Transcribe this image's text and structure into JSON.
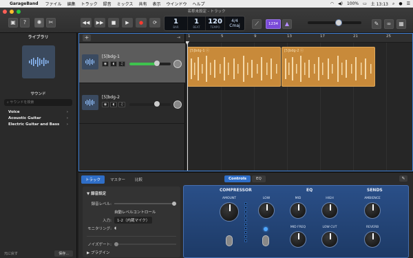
{
  "menubar": {
    "apple": "",
    "app": "GarageBand",
    "items": [
      "ファイル",
      "編集",
      "トラック",
      "録音",
      "ミックス",
      "共有",
      "表示",
      "ウインドウ",
      "ヘルプ"
    ],
    "battery": "100%",
    "time": "土 13:13"
  },
  "window": {
    "title": "名称未設定 - トラック"
  },
  "lcd": {
    "bar": "1",
    "beat": "1",
    "bar_label": "BAR",
    "beat_label": "BEAT",
    "tempo": "120",
    "tempo_label": "TEMPO",
    "sig": "4/4",
    "key": "Cmaj"
  },
  "transport": {
    "count_in": "1234"
  },
  "library": {
    "title": "ライブラリ",
    "sounds_title": "サウンド",
    "search_placeholder": "サウンドを検索",
    "items": [
      "Voice",
      "Acoustic Guitar",
      "Electric Guitar and Bass"
    ],
    "revert": "元に戻す",
    "save": "保存..."
  },
  "tracks": [
    {
      "name": "[5]bdg-1",
      "level": 0.62
    },
    {
      "name": "[5]bdg-2",
      "level": 0.0
    }
  ],
  "ruler": [
    "1",
    "5",
    "9",
    "13",
    "17",
    "21",
    "25"
  ],
  "regions": [
    {
      "name": "[5]bdg-1 ⓒ"
    },
    {
      "name": "[5]bdg-2 ⓒ"
    }
  ],
  "bottom": {
    "tabs": [
      "トラック",
      "マスター",
      "比較"
    ],
    "controls_tab": "Controls",
    "eq_tab": "EQ",
    "settings": {
      "header": "▼ 録音設定",
      "rec_level": "録音レベル:",
      "auto_level": "自動レベルコントロール",
      "input_label": "入力:",
      "input_value": "1-2（内蔵マイク）",
      "monitor": "モニタリング:",
      "noise_gate": "ノイズゲート:",
      "plugins": "▶ プラグイン"
    },
    "plugin": {
      "compressor": "COMPRESSOR",
      "eq": "EQ",
      "sends": "SENDS",
      "amount": "AMOUNT",
      "low": "LOW",
      "mid": "MID",
      "high": "HIGH",
      "mid_freq": "MID FREQ",
      "low_cut": "LOW CUT",
      "ambience": "AMBIENCE",
      "reverb": "REVERB"
    }
  }
}
